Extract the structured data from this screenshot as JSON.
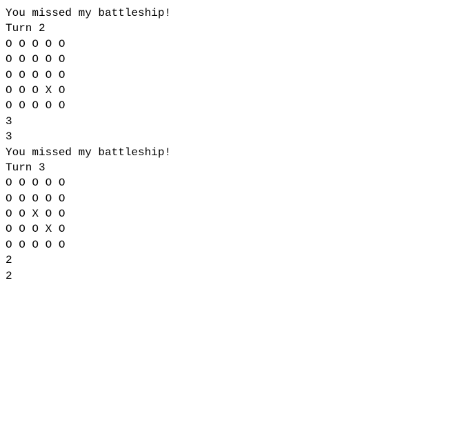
{
  "game": {
    "lines": [
      "You missed my battleship!",
      "Turn 2",
      "O O O O O",
      "O O O O O",
      "O O O O O",
      "O O O X O",
      "O O O O O",
      "3",
      "3",
      "You missed my battleship!",
      "Turn 3",
      "O O O O O",
      "O O O O O",
      "O O X O O",
      "O O O X O",
      "O O O O O",
      "2",
      "2"
    ]
  }
}
